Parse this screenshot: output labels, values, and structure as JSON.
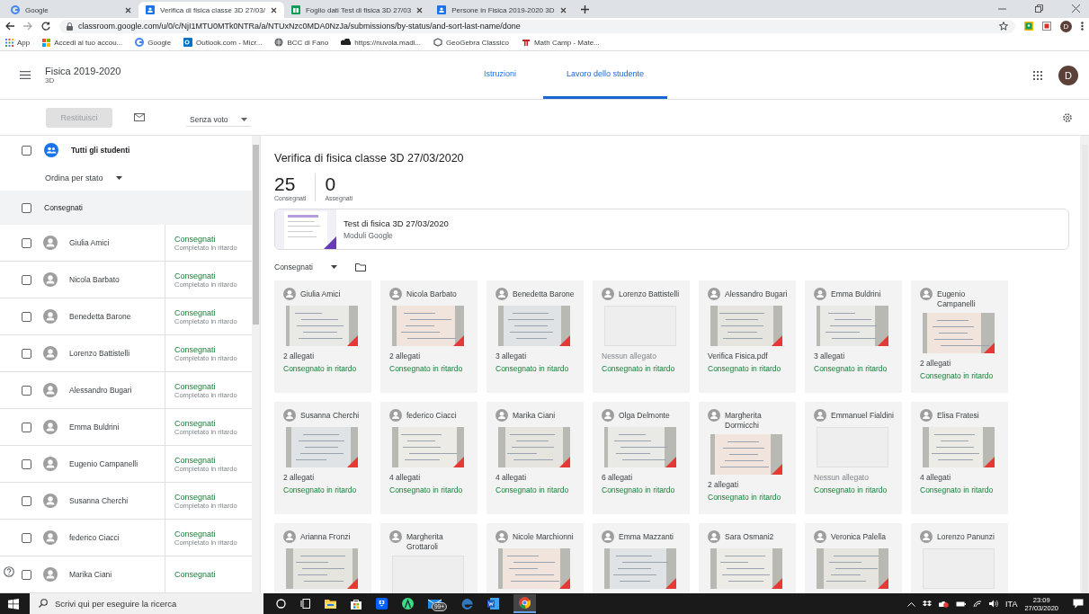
{
  "browser": {
    "tabs": [
      {
        "title": "Google",
        "kind": "google",
        "selected": false
      },
      {
        "title": "Verifica di fisica classe 3D 27/03/",
        "kind": "classroom",
        "selected": true
      },
      {
        "title": "Foglio dati Test di fisica 3D 27/03",
        "kind": "sheets",
        "selected": false
      },
      {
        "title": "Persone in Fisica 2019-2020 3D",
        "kind": "classroom",
        "selected": false
      }
    ],
    "address": "classroom.google.com/u/0/c/NjI1MTU0MTk0NTRa/a/NTUxNzc0MDA0NzJa/submissions/by-status/and-sort-last-name/done",
    "bookmarks": [
      {
        "label": "App",
        "kind": "apps"
      },
      {
        "label": "Accedi al tuo accou...",
        "kind": "windows"
      },
      {
        "label": "Google",
        "kind": "google"
      },
      {
        "label": "Outlook.com - Micr...",
        "kind": "outlook"
      },
      {
        "label": "BCC di Fano",
        "kind": "globe"
      },
      {
        "label": "https://nuvola.madi...",
        "kind": "cloud"
      },
      {
        "label": "GeoGebra Classico",
        "kind": "geogebra"
      },
      {
        "label": "Math Camp - Mate...",
        "kind": "mathcamp"
      }
    ],
    "profile": "D"
  },
  "course": {
    "name": "Fisica 2019-2020",
    "section": "3D",
    "avatar": "D",
    "tabs": [
      {
        "label": "Istruzioni",
        "selected": false
      },
      {
        "label": "Lavoro dello studente",
        "selected": true
      }
    ]
  },
  "toolbar": {
    "return_button": {
      "label": "Restituisci",
      "disabled": true
    },
    "grade_filter": "Senza voto"
  },
  "students_panel": {
    "all_students": {
      "label": "Tutti gli studenti",
      "checked": false
    },
    "sort": "Ordina per stato",
    "group": {
      "label": "Consegnati",
      "checked": false
    },
    "rows": [
      {
        "name": "Giulia Amici",
        "status": "Consegnati",
        "detail": "Completato in ritardo",
        "checked": false
      },
      {
        "name": "Nicola Barbato",
        "status": "Consegnati",
        "detail": "Completato in ritardo",
        "checked": false
      },
      {
        "name": "Benedetta Barone",
        "status": "Consegnati",
        "detail": "Completato in ritardo",
        "checked": false
      },
      {
        "name": "Lorenzo Battistelli",
        "status": "Consegnati",
        "detail": "Completato in ritardo",
        "checked": false
      },
      {
        "name": "Alessandro Bugari",
        "status": "Consegnati",
        "detail": "Completato in ritardo",
        "checked": false
      },
      {
        "name": "Emma Buldrini",
        "status": "Consegnati",
        "detail": "Completato in ritardo",
        "checked": false
      },
      {
        "name": "Eugenio Campanelli",
        "status": "Consegnati",
        "detail": "Completato in ritardo",
        "checked": false
      },
      {
        "name": "Susanna Cherchi",
        "status": "Consegnati",
        "detail": "Completato in ritardo",
        "checked": false
      },
      {
        "name": "federico Ciacci",
        "status": "Consegnati",
        "detail": "Completato in ritardo",
        "checked": false
      },
      {
        "name": "Marika Ciani",
        "status": "Consegnati",
        "checked": false
      }
    ]
  },
  "assignment": {
    "title": "Verifica di fisica classe 3D 27/03/2020",
    "counts": [
      {
        "value": "25",
        "label": "Consegnati"
      },
      {
        "value": "0",
        "label": "Assegnati"
      }
    ],
    "attachment": {
      "title": "Test di fisica 3D 27/03/2020",
      "subtitle": "Moduli Google"
    },
    "filter": "Consegnati",
    "cards": [
      {
        "name": "Giulia Amici",
        "has_attachment": true,
        "attachments": "2 allegati",
        "status": "Consegnato in ritardo"
      },
      {
        "name": "Nicola Barbato",
        "has_attachment": true,
        "attachments": "2 allegati",
        "status": "Consegnato in ritardo"
      },
      {
        "name": "Benedetta Barone",
        "has_attachment": true,
        "attachments": "3 allegati",
        "status": "Consegnato in ritardo"
      },
      {
        "name": "Lorenzo Battistelli",
        "has_attachment": false,
        "attachments": "Nessun allegato",
        "status": "Consegnato in ritardo"
      },
      {
        "name": "Alessandro Bugari",
        "has_attachment": true,
        "attachments": "Verifica Fisica.pdf",
        "status": "Consegnato in ritardo"
      },
      {
        "name": "Emma Buldrini",
        "has_attachment": true,
        "attachments": "3 allegati",
        "status": "Consegnato in ritardo"
      },
      {
        "name": "Eugenio Campanelli",
        "has_attachment": true,
        "attachments": "2 allegati",
        "status": "Consegnato in ritardo"
      },
      {
        "name": "Susanna Cherchi",
        "has_attachment": true,
        "attachments": "2 allegati",
        "status": "Consegnato in ritardo"
      },
      {
        "name": "federico Ciacci",
        "has_attachment": true,
        "attachments": "4 allegati",
        "status": "Consegnato in ritardo"
      },
      {
        "name": "Marika Ciani",
        "has_attachment": true,
        "attachments": "4 allegati",
        "status": "Consegnato in ritardo"
      },
      {
        "name": "Olga Delmonte",
        "has_attachment": true,
        "attachments": "6 allegati",
        "status": "Consegnato in ritardo"
      },
      {
        "name": "Margherita Dormicchi",
        "has_attachment": true,
        "attachments": "2 allegati",
        "status": "Consegnato in ritardo"
      },
      {
        "name": "Emmanuel Fialdini",
        "has_attachment": false,
        "attachments": "Nessun allegato",
        "status": "Consegnato in ritardo"
      },
      {
        "name": "Elisa Fratesi",
        "has_attachment": true,
        "attachments": "4 allegati",
        "status": "Consegnato in ritardo"
      },
      {
        "name": "Arianna Fronzi",
        "has_attachment": true
      },
      {
        "name": "Margherita Grottaroli",
        "has_attachment": false
      },
      {
        "name": "Nicole Marchionni",
        "has_attachment": true
      },
      {
        "name": "Emma Mazzanti",
        "has_attachment": true
      },
      {
        "name": "Sara Osmani2",
        "has_attachment": true
      },
      {
        "name": "Veronica Palella",
        "has_attachment": true
      },
      {
        "name": "Lorenzo Panunzi",
        "has_attachment": false
      }
    ]
  },
  "taskbar": {
    "search_placeholder": "Scrivi qui per eseguire la ricerca",
    "mail_badge": "99+",
    "language": "ITA",
    "time": "23:09",
    "date": "27/03/2020"
  }
}
